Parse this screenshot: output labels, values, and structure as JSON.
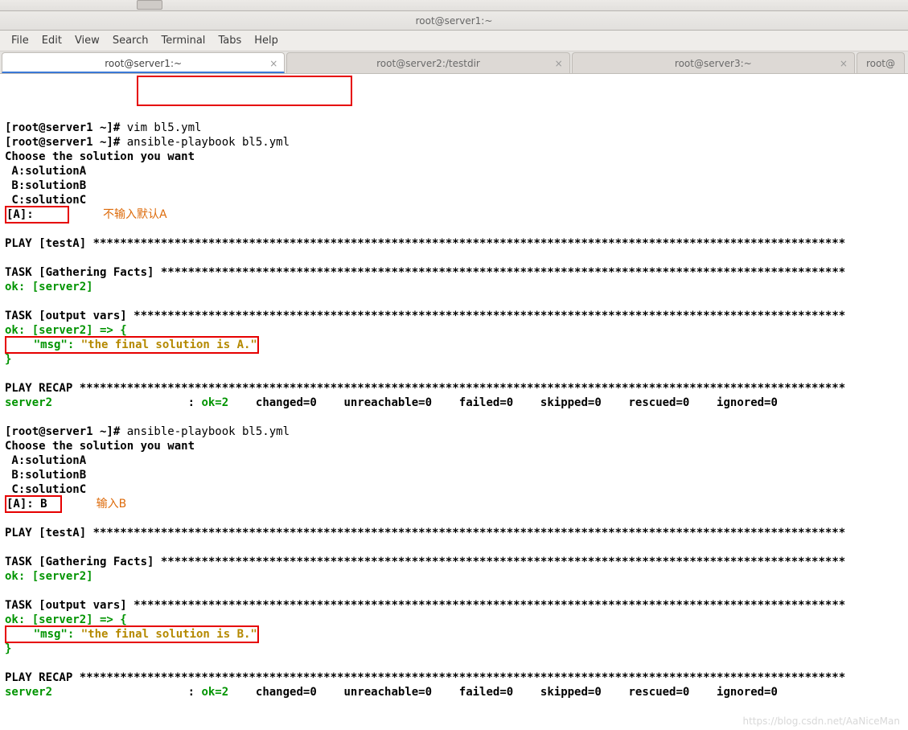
{
  "window": {
    "title": "root@server1:~"
  },
  "menubar": [
    "File",
    "Edit",
    "View",
    "Search",
    "Terminal",
    "Tabs",
    "Help"
  ],
  "tabs": [
    {
      "label": "root@server1:~",
      "active": true
    },
    {
      "label": "root@server2:/testdir",
      "active": false
    },
    {
      "label": "root@server3:~",
      "active": false
    },
    {
      "label": "root@",
      "active": false,
      "partial": true
    }
  ],
  "terminal": {
    "prompt": "[root@server1 ~]# ",
    "cmd1": "vim bl5.yml",
    "cmd2": "ansible-playbook bl5.yml",
    "choose_line": "Choose the solution you want",
    "optA": " A:solutionA",
    "optB": " B:solutionB",
    "optC": " C:solutionC",
    "input1": "[A]: ",
    "annotation1": "不输入默认A",
    "play_header": "PLAY [testA] ",
    "task_gather": "TASK [Gathering Facts] ",
    "ok_server2": "ok: [server2]",
    "task_output": "TASK [output vars] ",
    "ok_arrow": "ok: [server2] => {",
    "msg_key": "    \"msg\"",
    "msg_colon": ": ",
    "msg_val_a": "\"the final solution is A.\"",
    "close_brace": "}",
    "play_recap": "PLAY RECAP ",
    "recap_host": "server2",
    "recap_mid": "                    : ",
    "recap_ok": "ok=2   ",
    "recap_rest": " changed=0    unreachable=0    failed=0    skipped=0    rescued=0    ignored=0",
    "cmd3": "ansible-playbook bl5.yml",
    "input2": "[A]: B",
    "annotation2": "输入B",
    "msg_val_b": "\"the final solution is B.\"",
    "stars_play": "***************************************************************************************************************",
    "stars_task_g": "*****************************************************************************************************",
    "stars_task_o": "*********************************************************************************************************",
    "stars_recap": "*****************************************************************************************************************"
  },
  "watermark": "https://blog.csdn.net/AaNiceMan"
}
